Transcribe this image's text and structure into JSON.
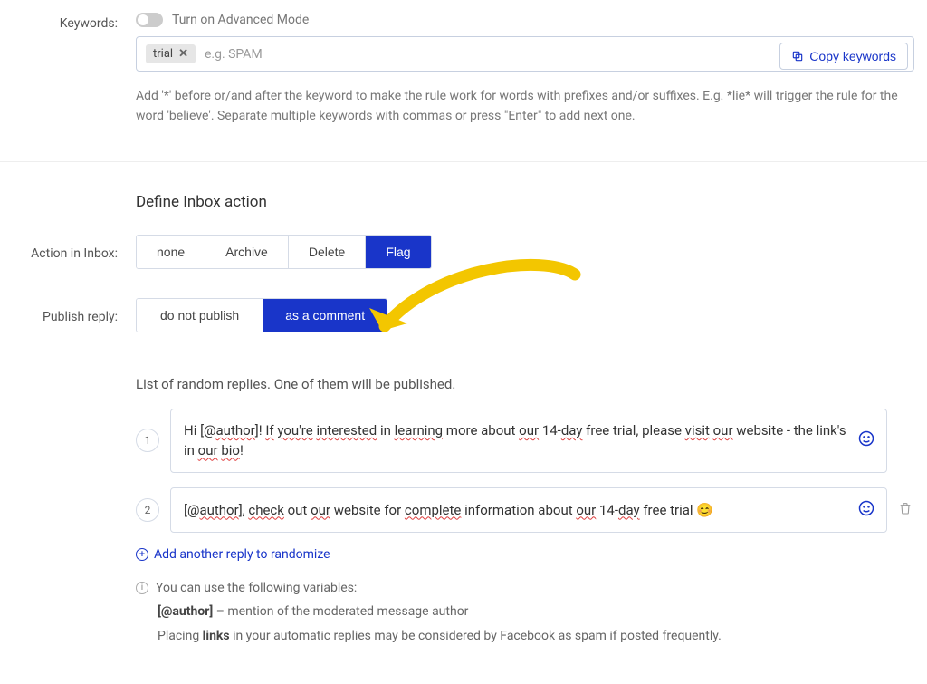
{
  "keywords": {
    "label": "Keywords:",
    "advanced_toggle_label": "Turn on Advanced Mode",
    "chip_value": "trial",
    "placeholder": "e.g. SPAM",
    "copy_button": "Copy keywords",
    "help_text": "Add '*' before or/and after the keyword to make the rule work for words with prefixes and/or suffixes. E.g. *lie* will trigger the rule for the word 'believe'. Separate multiple keywords with commas or press \"Enter\" to add next one."
  },
  "inbox_action": {
    "title": "Define Inbox action",
    "label": "Action in Inbox:",
    "options": {
      "none": "none",
      "archive": "Archive",
      "delete": "Delete",
      "flag": "Flag"
    },
    "selected": "flag"
  },
  "publish_reply": {
    "label": "Publish reply:",
    "options": {
      "no_publish": "do not publish",
      "as_comment": "as a comment"
    },
    "selected": "as_comment"
  },
  "replies": {
    "list_label": "List of random replies. One of them will be published.",
    "add_link": "Add another reply to randomize",
    "items": [
      {
        "n": "1",
        "text": "Hi [@author]! If you're interested in learning more about our 14-day free trial, please visit our website - the link's in our bio!"
      },
      {
        "n": "2",
        "text": "[@author], check out our website for complete information about our 14-day free trial 😊"
      }
    ]
  },
  "info": {
    "head": "You can use the following variables:",
    "author_var": "[@author]",
    "author_desc": " – mention of the moderated message author",
    "links_prefix": "Placing ",
    "links_bold": "links",
    "links_rest": " in your automatic replies may be considered by Facebook as spam if posted frequently."
  }
}
